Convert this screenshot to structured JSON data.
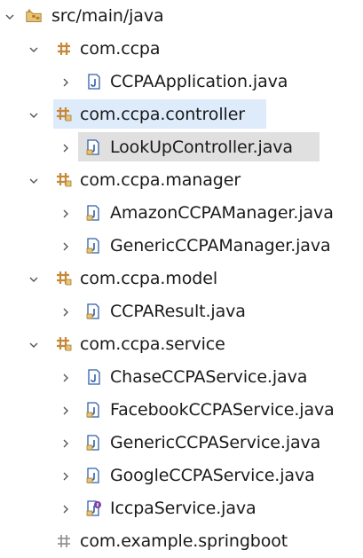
{
  "tree": {
    "root": {
      "label": "src/main/java",
      "icon": "source-folder-icon",
      "expanded": true
    },
    "items": [
      {
        "label": "com.ccpa",
        "icon": "package-icon",
        "expanded": true,
        "kind": "package"
      },
      {
        "label": "CCPAApplication.java",
        "icon": "java-file-icon",
        "kind": "file"
      },
      {
        "label": "com.ccpa.controller",
        "icon": "package-icon",
        "expanded": true,
        "kind": "package",
        "selected": true
      },
      {
        "label": "LookUpController.java",
        "icon": "java-file-icon",
        "kind": "file",
        "focused": true
      },
      {
        "label": "com.ccpa.manager",
        "icon": "package-icon",
        "expanded": true,
        "kind": "package"
      },
      {
        "label": "AmazonCCPAManager.java",
        "icon": "java-file-icon",
        "kind": "file"
      },
      {
        "label": "GenericCCPAManager.java",
        "icon": "java-file-icon",
        "kind": "file"
      },
      {
        "label": "com.ccpa.model",
        "icon": "package-icon",
        "expanded": true,
        "kind": "package"
      },
      {
        "label": "CCPAResult.java",
        "icon": "java-file-icon",
        "kind": "file"
      },
      {
        "label": "com.ccpa.service",
        "icon": "package-icon",
        "expanded": true,
        "kind": "package"
      },
      {
        "label": "ChaseCCPAService.java",
        "icon": "java-file-icon",
        "kind": "file"
      },
      {
        "label": "FacebookCCPAService.java",
        "icon": "java-file-icon",
        "kind": "file"
      },
      {
        "label": "GenericCCPAService.java",
        "icon": "java-file-icon",
        "kind": "file"
      },
      {
        "label": "GoogleCCPAService.java",
        "icon": "java-file-icon",
        "kind": "file"
      },
      {
        "label": "IccpaService.java",
        "icon": "java-interface-file-icon",
        "kind": "file"
      },
      {
        "label": "com.example.springboot",
        "icon": "empty-package-icon",
        "kind": "package-empty"
      }
    ]
  },
  "colors": {
    "selection": "#ddebfb",
    "focus": "#e0e0e0",
    "package": "#c8883a",
    "file": "#2f5fa8",
    "interface": "#7b3fa8"
  }
}
